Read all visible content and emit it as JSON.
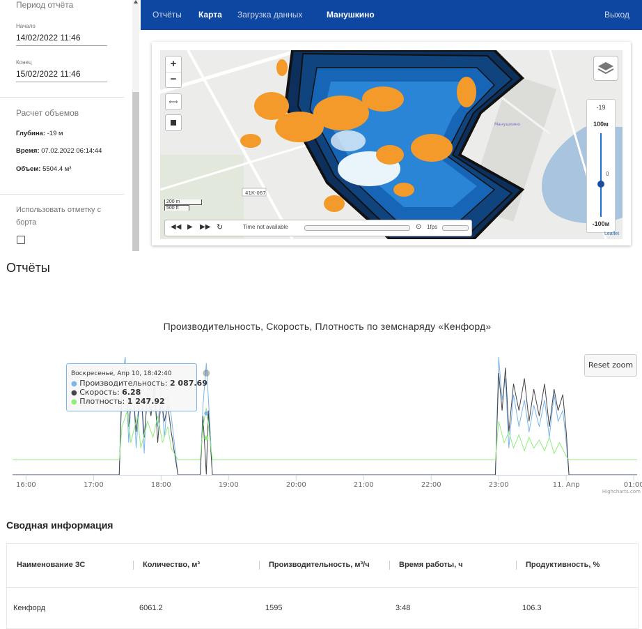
{
  "sidebar": {
    "period_title": "Период отчёта",
    "start_label": "Начало",
    "start_value": "14/02/2022 11:46",
    "end_label": "Конец",
    "end_value": "15/02/2022 11:46",
    "volume_title": "Расчет объемов",
    "depth_label": "Глубина:",
    "depth_value": "-19 м",
    "time_label": "Время:",
    "time_value": "07.02.2022 06:14:44",
    "volume_label": "Объем:",
    "volume_value": "5504.4 м³",
    "use_mark_label": "Использовать отметку с борта",
    "use_mark_checked": false
  },
  "nav": {
    "items": [
      "Отчёты",
      "Карта",
      "Загрузка данных"
    ],
    "active": "Карта",
    "user": "Манушкино",
    "logout": "Выход",
    "bg_color": "#0d47a1"
  },
  "map": {
    "zoom_in": "+",
    "zoom_out": "−",
    "scale_m": "200 m",
    "scale_ft": "500 ft",
    "road_label": "41К-067",
    "time_status": "Time not available",
    "fps_label": "1fps",
    "depth_top": "-19",
    "depth_max_label": "100м",
    "depth_zero": "0",
    "depth_min_label": "-100м",
    "attribution": "Leaflet",
    "poi_label": "Манушкино",
    "layers_icon": "layers-icon"
  },
  "reports_title": "Отчёты",
  "chart_data": {
    "type": "line",
    "title": "Производительность, Скорость, Плотность по земснаряду «Кенфорд»",
    "x_ticks": [
      "16:00",
      "17:00",
      "18:00",
      "19:00",
      "20:00",
      "21:00",
      "22:00",
      "23:00",
      "11. Апр",
      "01:00"
    ],
    "x_range_hours": [
      15.8,
      25.05
    ],
    "credits": "Highcharts.com",
    "reset_zoom": "Reset zoom",
    "series": [
      {
        "name": "Производительность",
        "color": "#7cb5ec",
        "points": [
          [
            15.8,
            0
          ],
          [
            17.38,
            0
          ],
          [
            17.42,
            1800
          ],
          [
            17.47,
            2200
          ],
          [
            17.52,
            600
          ],
          [
            17.58,
            1900
          ],
          [
            17.63,
            500
          ],
          [
            17.7,
            1700
          ],
          [
            17.75,
            400
          ],
          [
            17.8,
            1800
          ],
          [
            17.85,
            1200
          ],
          [
            17.9,
            1500
          ],
          [
            17.95,
            900
          ],
          [
            18.0,
            1600
          ],
          [
            18.05,
            700
          ],
          [
            18.1,
            1500
          ],
          [
            18.15,
            1100
          ],
          [
            18.25,
            0
          ],
          [
            18.58,
            0
          ],
          [
            18.62,
            1300
          ],
          [
            18.67,
            2087.69
          ],
          [
            18.72,
            1000
          ],
          [
            18.76,
            0
          ],
          [
            22.95,
            0
          ],
          [
            23.0,
            2200
          ],
          [
            23.05,
            1400
          ],
          [
            23.1,
            1800
          ],
          [
            23.15,
            500
          ],
          [
            23.22,
            1500
          ],
          [
            23.3,
            900
          ],
          [
            23.38,
            1400
          ],
          [
            23.45,
            800
          ],
          [
            23.52,
            1300
          ],
          [
            23.6,
            900
          ],
          [
            23.68,
            1400
          ],
          [
            23.75,
            700
          ],
          [
            23.82,
            1500
          ],
          [
            23.88,
            1000
          ],
          [
            23.95,
            1200
          ],
          [
            24.0,
            600
          ],
          [
            24.04,
            0
          ],
          [
            25.05,
            0
          ]
        ]
      },
      {
        "name": "Скорость",
        "color": "#434348",
        "points": [
          [
            15.8,
            0
          ],
          [
            17.38,
            0
          ],
          [
            17.42,
            1600
          ],
          [
            17.47,
            2000
          ],
          [
            17.52,
            900
          ],
          [
            17.58,
            1700
          ],
          [
            17.63,
            800
          ],
          [
            17.7,
            1600
          ],
          [
            17.75,
            700
          ],
          [
            17.8,
            1500
          ],
          [
            17.85,
            1100
          ],
          [
            17.9,
            1700
          ],
          [
            17.95,
            600
          ],
          [
            18.0,
            1400
          ],
          [
            18.05,
            1000
          ],
          [
            18.1,
            1300
          ],
          [
            18.15,
            800
          ],
          [
            18.25,
            0
          ],
          [
            18.58,
            0
          ],
          [
            18.62,
            1100
          ],
          [
            18.67,
            6.28
          ],
          [
            18.7,
            1200
          ],
          [
            18.76,
            0
          ],
          [
            22.95,
            0
          ],
          [
            23.0,
            1900
          ],
          [
            23.05,
            1200
          ],
          [
            23.1,
            2000
          ],
          [
            23.15,
            800
          ],
          [
            23.22,
            1700
          ],
          [
            23.3,
            1200
          ],
          [
            23.38,
            1800
          ],
          [
            23.45,
            1000
          ],
          [
            23.52,
            1600
          ],
          [
            23.6,
            1100
          ],
          [
            23.68,
            1700
          ],
          [
            23.75,
            900
          ],
          [
            23.82,
            1600
          ],
          [
            23.88,
            1200
          ],
          [
            23.95,
            1500
          ],
          [
            24.0,
            800
          ],
          [
            24.04,
            0
          ],
          [
            25.05,
            0
          ]
        ]
      },
      {
        "name": "Плотность",
        "color": "#90ed7d",
        "points": [
          [
            15.8,
            280
          ],
          [
            17.38,
            280
          ],
          [
            17.42,
            900
          ],
          [
            17.5,
            1200
          ],
          [
            17.55,
            600
          ],
          [
            17.65,
            1100
          ],
          [
            17.7,
            500
          ],
          [
            17.8,
            1000
          ],
          [
            17.88,
            700
          ],
          [
            17.95,
            1100
          ],
          [
            18.02,
            600
          ],
          [
            18.1,
            900
          ],
          [
            18.15,
            500
          ],
          [
            18.25,
            280
          ],
          [
            18.58,
            280
          ],
          [
            18.62,
            900
          ],
          [
            18.67,
            1247.92
          ],
          [
            18.72,
            700
          ],
          [
            18.76,
            280
          ],
          [
            22.95,
            280
          ],
          [
            23.0,
            1000
          ],
          [
            23.08,
            600
          ],
          [
            23.15,
            800
          ],
          [
            23.22,
            500
          ],
          [
            23.3,
            750
          ],
          [
            23.38,
            450
          ],
          [
            23.45,
            700
          ],
          [
            23.52,
            500
          ],
          [
            23.6,
            650
          ],
          [
            23.68,
            450
          ],
          [
            23.75,
            700
          ],
          [
            23.82,
            400
          ],
          [
            23.9,
            600
          ],
          [
            24.0,
            350
          ],
          [
            24.04,
            280
          ],
          [
            25.05,
            280
          ]
        ]
      }
    ],
    "y_range": [
      0,
      2200
    ],
    "tooltip": {
      "header": "Воскресенье, Апр 10, 18:42:40",
      "lines": [
        {
          "name": "Производительность",
          "value": "2 087.69"
        },
        {
          "name": "Скорость",
          "value": "6.28"
        },
        {
          "name": "Плотность",
          "value": "1 247.92"
        }
      ]
    }
  },
  "summary": {
    "title": "Сводная информация",
    "columns": [
      "Наименование ЗС",
      "Количество, м³",
      "Производительность, м³/ч",
      "Время работы, ч",
      "Продуктивность, %"
    ],
    "rows": [
      [
        "Кенфорд",
        "6061.2",
        "1595",
        "3:48",
        "106.3"
      ]
    ]
  }
}
